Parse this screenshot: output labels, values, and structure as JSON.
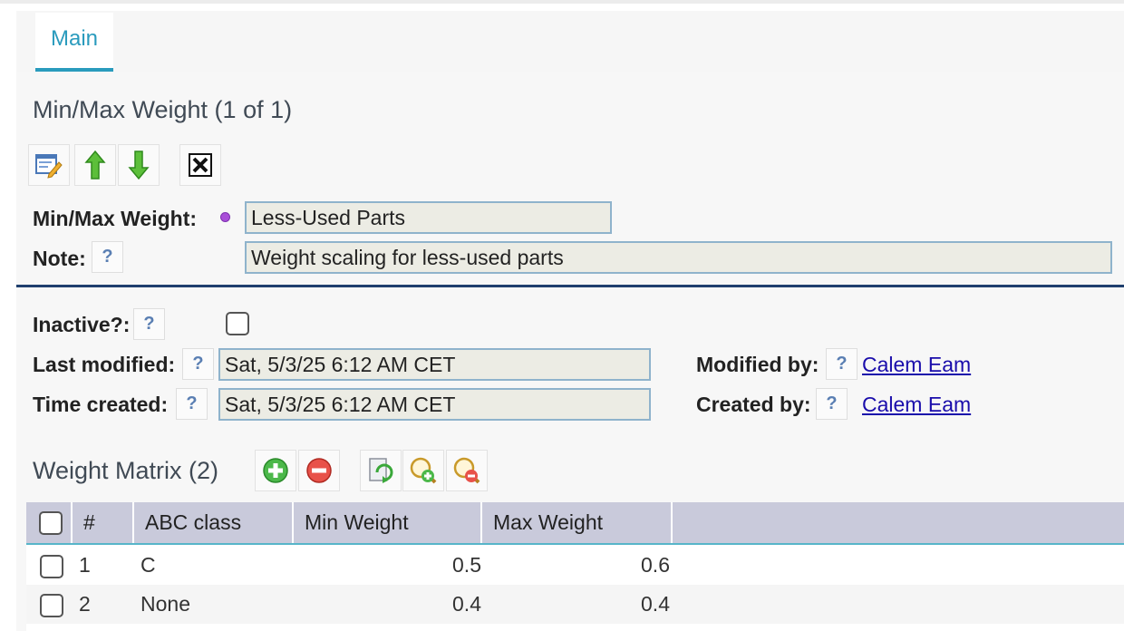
{
  "tabs": [
    {
      "label": "Main"
    }
  ],
  "section": {
    "title": "Min/Max Weight (1 of 1)",
    "toolbar": [
      {
        "icon": "edit-icon"
      },
      {
        "icon": "arrow-up-icon"
      },
      {
        "icon": "arrow-down-icon"
      },
      {
        "icon": "close-icon"
      }
    ]
  },
  "form": {
    "weight_label": "Min/Max Weight:",
    "weight_value": "Less-Used Parts",
    "note_label": "Note:",
    "note_value": "Weight scaling for less-used parts",
    "inactive_label": "Inactive?:",
    "inactive_checked": false,
    "last_modified_label": "Last modified:",
    "last_modified_value": "Sat, 5/3/25 6:12 AM CET",
    "time_created_label": "Time created:",
    "time_created_value": "Sat, 5/3/25 6:12 AM CET",
    "modified_by_label": "Modified by:",
    "modified_by_value": "Calem Eam",
    "created_by_label": "Created by:",
    "created_by_value": "Calem Eam",
    "help_glyph": "?"
  },
  "matrix": {
    "title": "Weight Matrix (2)",
    "columns": [
      "#",
      "ABC class",
      "Min Weight",
      "Max Weight"
    ],
    "rows": [
      {
        "num": "1",
        "abc_class": "C",
        "min_weight": "0.5",
        "max_weight": "0.6"
      },
      {
        "num": "2",
        "abc_class": "None",
        "min_weight": "0.4",
        "max_weight": "0.4"
      }
    ]
  },
  "colors": {
    "accent": "#2a9bbd",
    "separator": "#1f3f6e",
    "grid_header": "#c9cadb",
    "link": "#1a0dab"
  }
}
